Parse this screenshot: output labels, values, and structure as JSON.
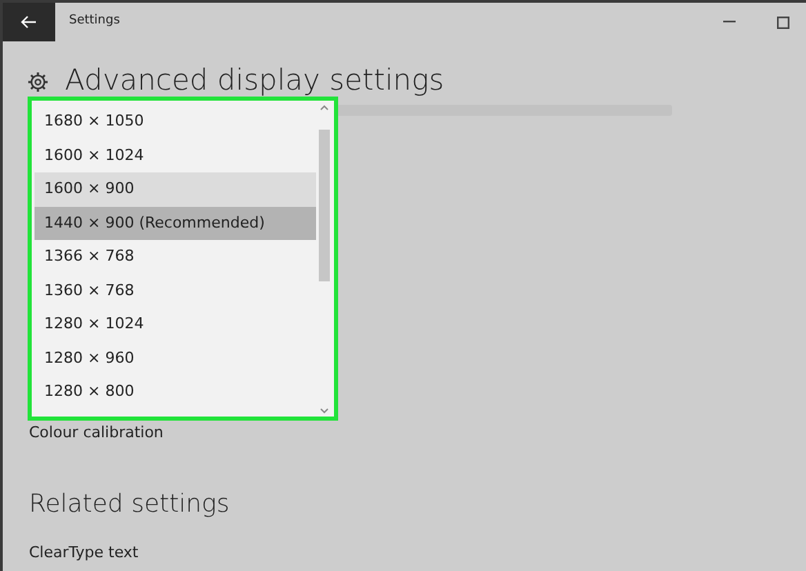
{
  "window": {
    "title": "Settings"
  },
  "page_title": "Advanced display settings",
  "resolution_dropdown": {
    "highlighted": true,
    "options": [
      {
        "label": "1680 × 1050",
        "selected": false,
        "hovered": false
      },
      {
        "label": "1600 × 1024",
        "selected": false,
        "hovered": false
      },
      {
        "label": "1600 × 900",
        "selected": false,
        "hovered": true
      },
      {
        "label": "1440 × 900 (Recommended)",
        "selected": true,
        "hovered": false
      },
      {
        "label": "1366 × 768",
        "selected": false,
        "hovered": false
      },
      {
        "label": "1360 × 768",
        "selected": false,
        "hovered": false
      },
      {
        "label": "1280 × 1024",
        "selected": false,
        "hovered": false
      },
      {
        "label": "1280 × 960",
        "selected": false,
        "hovered": false
      },
      {
        "label": "1280 × 800",
        "selected": false,
        "hovered": false
      }
    ]
  },
  "links": [
    "Colour calibration"
  ],
  "related": {
    "heading": "Related settings",
    "links": [
      "ClearType text"
    ]
  }
}
